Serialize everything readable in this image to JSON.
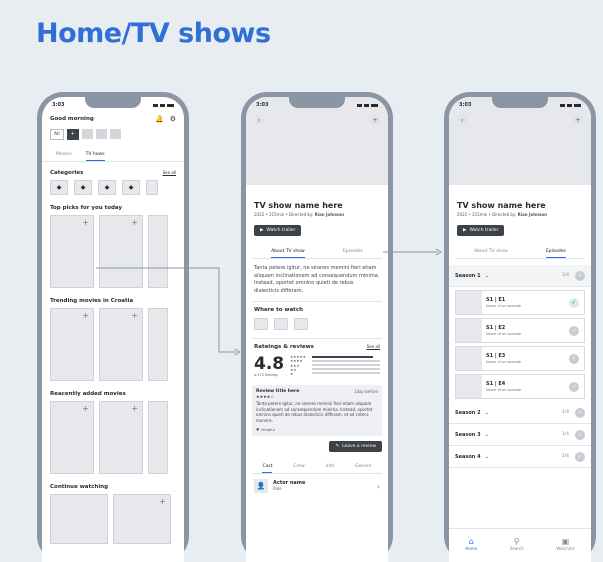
{
  "page_title": "Home/TV shows",
  "status_time": "3:03",
  "phone1": {
    "greeting": "Good morning",
    "filter_chips": [
      "All",
      "+"
    ],
    "tabs": [
      "Movies",
      "TV hows"
    ],
    "categories_title": "Categories",
    "see_all": "See all",
    "top_picks_title": "Top picks for you today",
    "trending_title": "Trending movies in Croatia",
    "recent_title": "Reacently added movies",
    "continue_title": "Continue watching"
  },
  "show": {
    "title": "TV show name here",
    "meta_prefix": "2022 • 215min • Directed by: ",
    "director": "Rian Johnson",
    "watch_trailer": "Watch trailer",
    "tabs": [
      "About TV show",
      "Episodes"
    ]
  },
  "phone2": {
    "synopsis": "Tanta petere igitur, ne sineres memini fieri etiam aliquam inclinationem ad consequendum minima. Instead, oportet omnino quieti de rebus dialecticis differam,",
    "where_title": "Where to watch",
    "ratings_title": "Rateings & reviews",
    "see_all": "See all",
    "rating_value": "4.8",
    "rating_count": "o.475 Ratings",
    "review_title": "Review title here",
    "review_date": "1day before",
    "review_stars": "★★★★☆",
    "review_text": "Tanta petere igitur, ne sineres memini fieri etiam aliquam inclinationem ad consequendum minima. Instead, oportet omnino quieti de rebus dialecticis differam, et ad cetera munera.",
    "helpful": "Helpful",
    "leave_review": "Leave a review",
    "bottom_tabs": [
      "Cast",
      "Crew",
      "Info",
      "Genere"
    ],
    "actor_name": "Actor name",
    "actor_role": "Role"
  },
  "phone3": {
    "seasons": [
      {
        "label": "Season 1",
        "count": "1/4"
      },
      {
        "label": "Season 2",
        "count": "1/4"
      },
      {
        "label": "Season 3",
        "count": "1/4"
      },
      {
        "label": "Season 4",
        "count": "1/4"
      }
    ],
    "episodes": [
      {
        "code": "S1 | E1",
        "name": "Name of an episode"
      },
      {
        "code": "S1 | E2",
        "name": "Name of an episode"
      },
      {
        "code": "S1 | E3",
        "name": "Name of an episode"
      },
      {
        "code": "S1 | E4",
        "name": "Name of an episode"
      }
    ],
    "nav": [
      "Home",
      "Search",
      "Watchlist"
    ]
  },
  "colors": {
    "accent": "#2f6fd6",
    "frame": "#8a96a3",
    "background": "#e8edf2"
  }
}
